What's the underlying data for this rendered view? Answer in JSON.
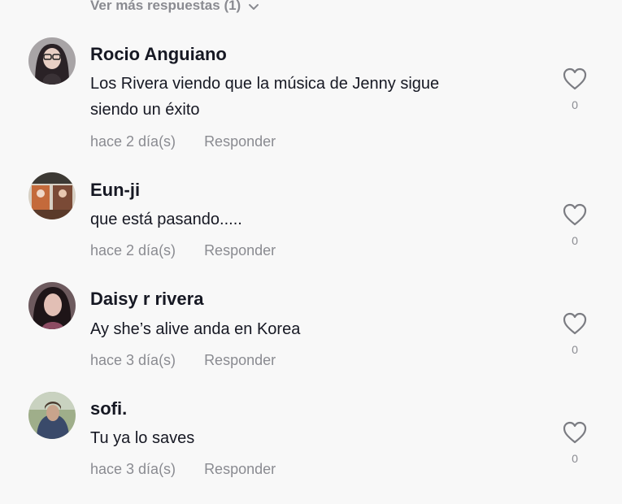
{
  "more_replies": {
    "label": "Ver más respuestas (1)",
    "icon": "chevron-down-icon"
  },
  "comments": [
    {
      "username": "Rocio Anguiano",
      "text_lines": [
        "Los Rivera viendo que la música de Jenny sigue",
        "siendo un éxito"
      ],
      "time": "hace 2 día(s)",
      "reply_label": "Responder",
      "likes": "0",
      "like_icon": "heart-outline-icon"
    },
    {
      "username": "Eun-ji",
      "text_lines": [
        "que está pasando....."
      ],
      "time": "hace 2 día(s)",
      "reply_label": "Responder",
      "likes": "0",
      "like_icon": "heart-outline-icon"
    },
    {
      "username": "Daisy r rivera",
      "text_lines": [
        "Ay she’s alive anda en Korea"
      ],
      "time": "hace 3 día(s)",
      "reply_label": "Responder",
      "likes": "0",
      "like_icon": "heart-outline-icon"
    },
    {
      "username": "sofi.",
      "text_lines": [
        "Tu ya lo saves"
      ],
      "time": "hace 3 día(s)",
      "reply_label": "Responder",
      "likes": "0",
      "like_icon": "heart-outline-icon"
    }
  ],
  "colors": {
    "background": "#f8f8f8",
    "primary_text": "#161823",
    "secondary_text": "#8a8b91"
  }
}
